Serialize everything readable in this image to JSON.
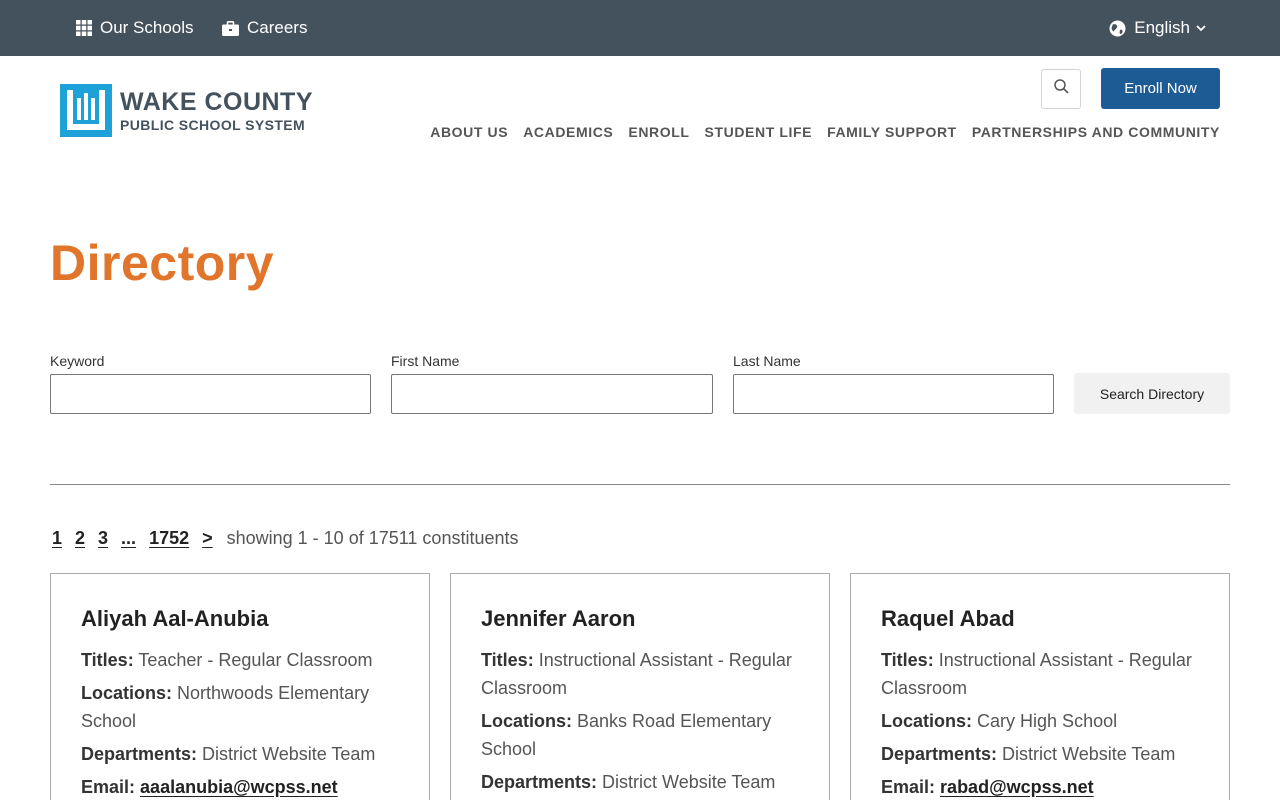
{
  "topbar": {
    "our_schools": "Our Schools",
    "careers": "Careers",
    "language": "English"
  },
  "header": {
    "logo_line1": "WAKE COUNTY",
    "logo_line2": "PUBLIC SCHOOL SYSTEM",
    "enroll_label": "Enroll Now",
    "nav": [
      "ABOUT US",
      "ACADEMICS",
      "ENROLL",
      "STUDENT LIFE",
      "FAMILY SUPPORT",
      "PARTNERSHIPS AND COMMUNITY"
    ]
  },
  "page": {
    "title": "Directory"
  },
  "search": {
    "keyword_label": "Keyword",
    "keyword_value": "",
    "first_name_label": "First Name",
    "first_name_value": "",
    "last_name_label": "Last Name",
    "last_name_value": "",
    "button_label": "Search Directory"
  },
  "pagination": {
    "pages": [
      "1",
      "2",
      "3",
      "...",
      "1752",
      ">"
    ],
    "summary": "showing 1 - 10 of 17511 constituents"
  },
  "field_keys": {
    "titles": "Titles:",
    "locations": "Locations:",
    "departments": "Departments:",
    "email": "Email:"
  },
  "people": [
    {
      "name": "Aliyah Aal-Anubia",
      "titles": "Teacher - Regular Classroom",
      "locations": "Northwoods Elementary School",
      "departments": "District Website Team",
      "email": "aaalanubia@wcpss.net"
    },
    {
      "name": "Jennifer Aaron",
      "titles": "Instructional Assistant - Regular Classroom",
      "locations": "Banks Road Elementary School",
      "departments": "District Website Team",
      "email": ""
    },
    {
      "name": "Raquel Abad",
      "titles": "Instructional Assistant - Regular Classroom",
      "locations": "Cary High School",
      "departments": "District Website Team",
      "email": "rabad@wcpss.net"
    }
  ],
  "colors": {
    "topbar": "#44525e",
    "accent_orange": "#e0752b",
    "enroll_blue": "#1c5b94",
    "logo_blue": "#1ea1d8"
  }
}
